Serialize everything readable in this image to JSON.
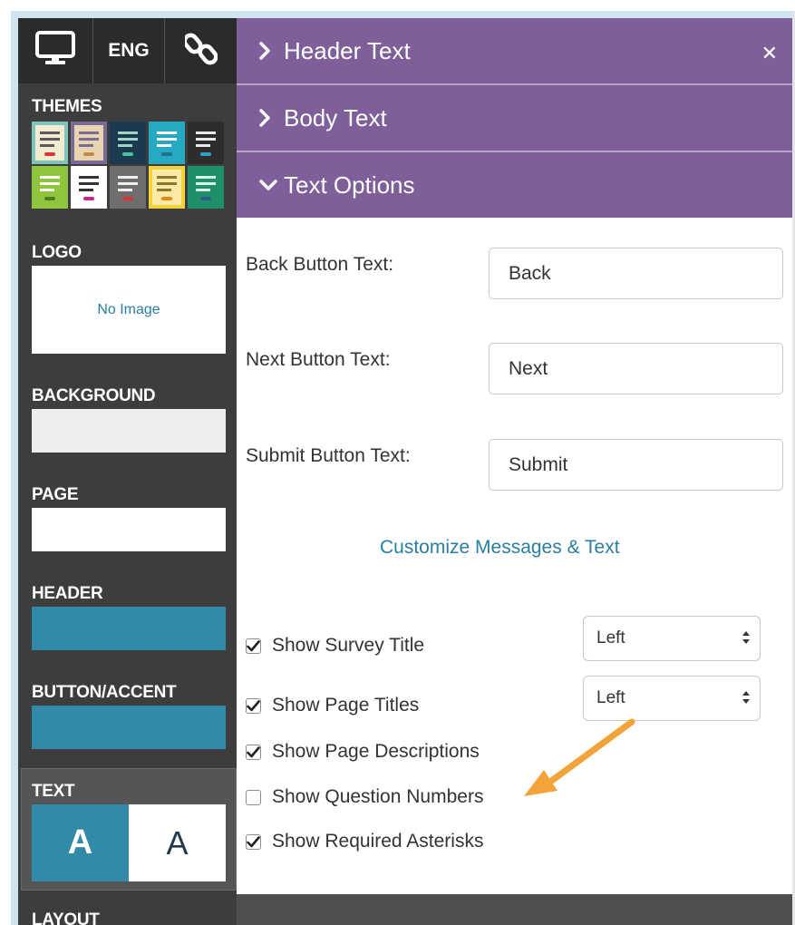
{
  "topbar": {
    "language_label": "ENG",
    "icons": [
      "desktop-icon",
      "link-icon"
    ]
  },
  "sidebar": {
    "themes_label": "THEMES",
    "logo_label": "LOGO",
    "logo_placeholder": "No Image",
    "background_label": "BACKGROUND",
    "page_label": "PAGE",
    "header_label": "HEADER",
    "button_accent_label": "BUTTON/ACCENT",
    "text_label": "TEXT",
    "text_options": [
      "A",
      "A"
    ],
    "layout_label": "LAYOUT",
    "colors": {
      "background": "#eeeeee",
      "page": "#ffffff",
      "header": "#338aa8",
      "button_accent": "#338aa8"
    }
  },
  "panel": {
    "sections": [
      {
        "label": "Header Text",
        "expanded": false
      },
      {
        "label": "Body Text",
        "expanded": false
      },
      {
        "label": "Text Options",
        "expanded": true
      }
    ],
    "fields": [
      {
        "label": "Back Button Text:",
        "value": "Back"
      },
      {
        "label": "Next Button Text:",
        "value": "Next"
      },
      {
        "label": "Submit Button Text:",
        "value": "Submit"
      }
    ],
    "customize_link": "Customize Messages & Text",
    "options": [
      {
        "label": "Show Survey Title",
        "checked": true,
        "alignment": "Left"
      },
      {
        "label": "Show Page Titles",
        "checked": true,
        "alignment": "Left"
      },
      {
        "label": "Show Page Descriptions",
        "checked": true
      },
      {
        "label": "Show Question Numbers",
        "checked": false
      },
      {
        "label": "Show Required Asterisks",
        "checked": true
      }
    ]
  },
  "annotation": {
    "arrow_color": "#f2a43a"
  }
}
